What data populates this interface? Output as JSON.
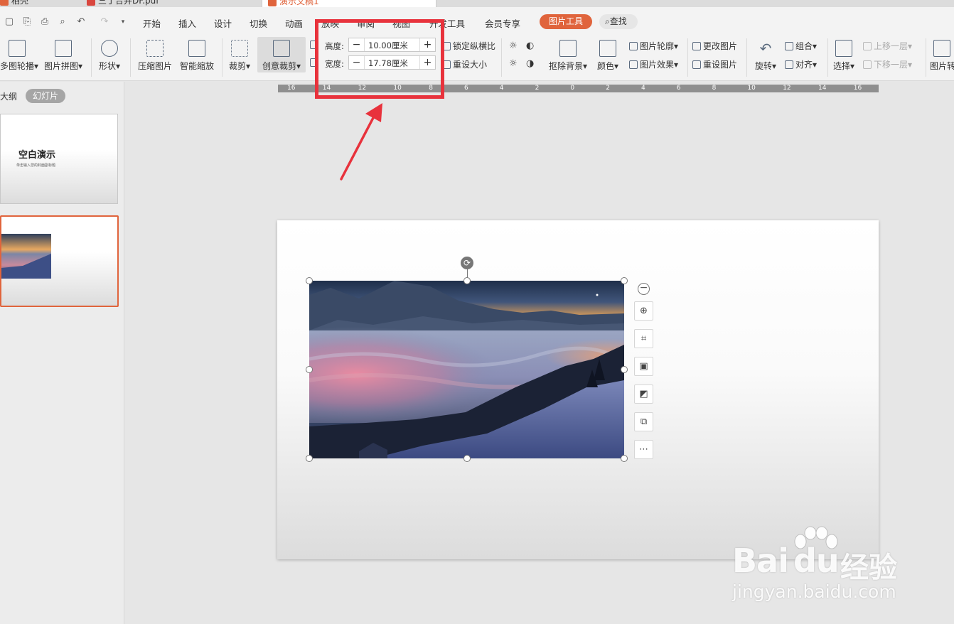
{
  "tabs": [
    {
      "label": "稻壳"
    },
    {
      "label": "三丁合并DF.pdf"
    },
    {
      "label": "演示文稿1"
    }
  ],
  "menu": {
    "items": [
      "开始",
      "插入",
      "设计",
      "切换",
      "动画",
      "放映",
      "审阅",
      "视图",
      "开发工具",
      "会员专享"
    ],
    "picture_tools": "图片工具",
    "search": "查找"
  },
  "ribbon": {
    "image_carousel": "多图轮播",
    "image_collage": "图片拼图",
    "shape": "形状",
    "compress": "压缩图片",
    "smart_zoom": "智能缩放",
    "crop": "裁剪",
    "creative_crop": "创意裁剪",
    "height_label": "高度:",
    "height_value": "10.00厘米",
    "width_label": "宽度:",
    "width_value": "17.78厘米",
    "lock_ratio": "锁定纵横比",
    "reset_size": "重设大小",
    "remove_bg": "抠除背景",
    "color": "颜色",
    "outline": "图片轮廓",
    "effects": "图片效果",
    "change_image": "更改图片",
    "reset_image": "重设图片",
    "rotate": "旋转",
    "group": "组合",
    "align": "对齐",
    "select": "选择",
    "bring_forward": "上移一层",
    "send_backward": "下移一层",
    "image_right": "图片转"
  },
  "ruler": {
    "labels": [
      "16",
      "14",
      "12",
      "10",
      "8",
      "6",
      "4",
      "2",
      "0",
      "2",
      "4",
      "6",
      "8",
      "10",
      "12",
      "14",
      "16"
    ]
  },
  "left_panel": {
    "outline_tab": "大纲",
    "slides_tab": "幻灯片",
    "slide1_title": "空白演示",
    "slide1_subtitle": "单击输入您的封面副标题"
  },
  "watermark": {
    "brand": "Bai",
    "brand2": "du",
    "cn": "经验",
    "url": "jingyan.baidu.com"
  },
  "colors": {
    "accent": "#e0643c",
    "annotation": "#e8323c"
  }
}
